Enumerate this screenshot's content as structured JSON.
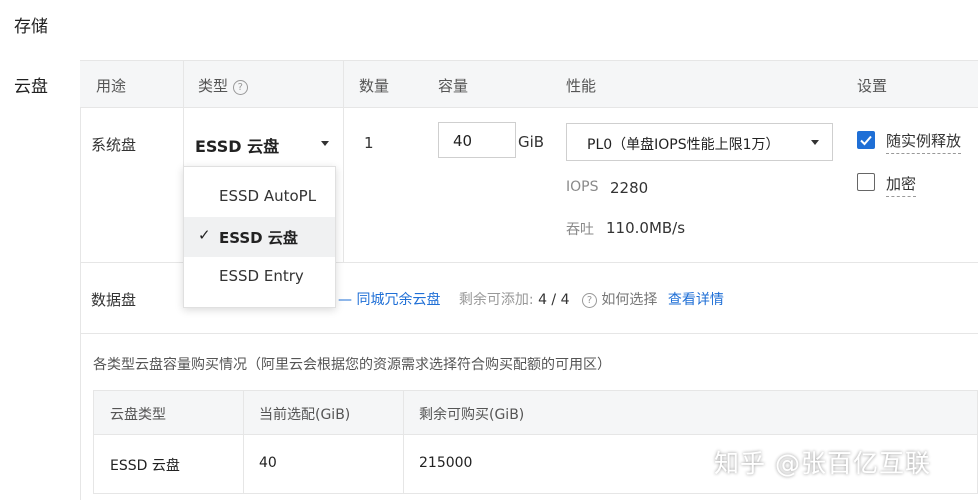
{
  "section_title": "存储",
  "cloud_disk_label": "云盘",
  "table_header": {
    "usage": "用途",
    "type": "类型",
    "count": "数量",
    "capacity": "容量",
    "performance": "性能",
    "settings": "设置"
  },
  "system_disk": {
    "label": "系统盘",
    "type_value": "ESSD 云盘",
    "count": "1",
    "capacity_value": "40",
    "capacity_unit": "GiB",
    "performance_value": "PL0（单盘IOPS性能上限1万）",
    "iops_label": "IOPS",
    "iops_value": "2280",
    "throughput_label": "吞吐",
    "throughput_value": "110.0MB/s",
    "release_label": "随实例释放",
    "release_checked": true,
    "encrypt_label": "加密",
    "encrypt_checked": false
  },
  "type_dropdown": {
    "options": [
      "ESSD AutoPL",
      "ESSD 云盘",
      "ESSD Entry"
    ],
    "selected_index": 1,
    "check_mark": "✓"
  },
  "data_disk": {
    "label": "数据盘",
    "redundant_link": "同城冗余云盘",
    "remaining_label": "剩余可添加:",
    "remaining_value": "4 / 4",
    "how_to_choose": "如何选择",
    "view_details": "查看详情"
  },
  "purchase_note": "各类型云盘容量购买情况（阿里云会根据您的资源需求选择符合购买配额的可用区）",
  "purchase_table": {
    "headers": [
      "云盘类型",
      "当前选配(GiB)",
      "剩余可购买(GiB)"
    ],
    "rows": [
      [
        "ESSD 云盘",
        "40",
        "215000"
      ]
    ]
  },
  "watermark_text": "知乎 @张百亿互联",
  "colors": {
    "accent": "#1f6fd6",
    "header_bg": "#f5f6f7",
    "border": "#e6e6e6"
  }
}
